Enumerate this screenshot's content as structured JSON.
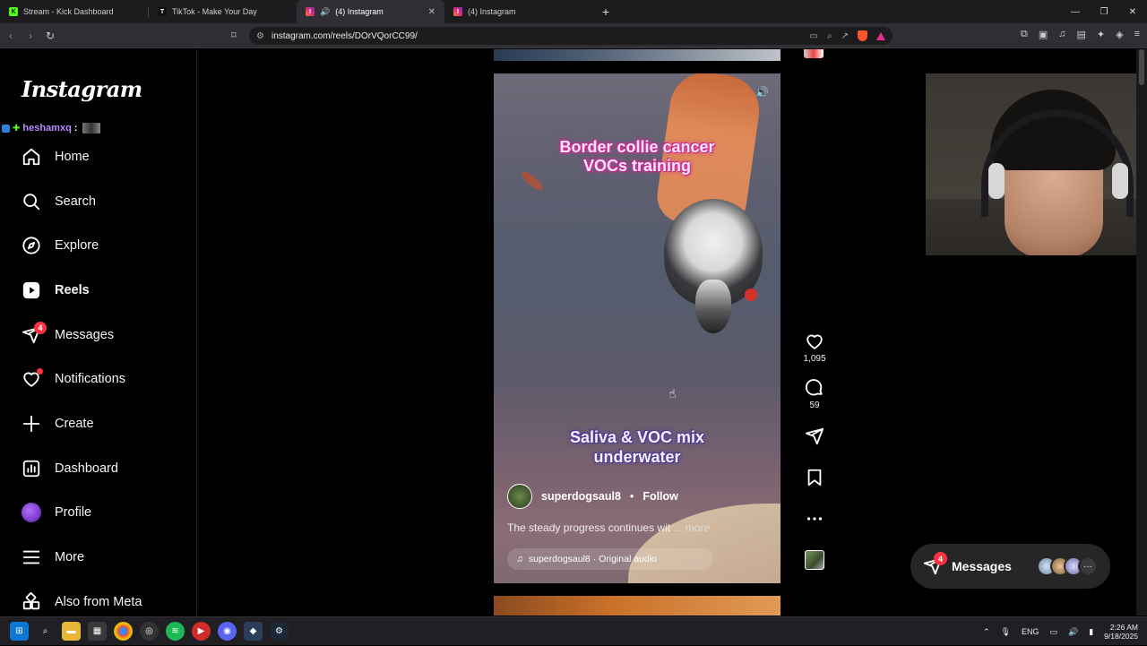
{
  "browser": {
    "tabs": [
      {
        "title": "Stream - Kick Dashboard",
        "favicon": "K",
        "favicon_color": "#53fc18"
      },
      {
        "title": "TikTok - Make Your Day",
        "favicon": "T",
        "favicon_color": "#111111"
      },
      {
        "title": "(4) Instagram",
        "favicon": "I",
        "favicon_color": "#d6249f",
        "active": true,
        "audio": true
      },
      {
        "title": "(4) Instagram",
        "favicon": "I",
        "favicon_color": "#d6249f"
      }
    ],
    "url": "instagram.com/reels/DOrVQorCC99/"
  },
  "instagram": {
    "logo": "Instagram",
    "chat_overlay": {
      "user": "heshamxq",
      "colon": ":"
    },
    "nav": [
      {
        "label": "Home",
        "icon": "home-icon"
      },
      {
        "label": "Search",
        "icon": "search-icon"
      },
      {
        "label": "Explore",
        "icon": "compass-icon"
      },
      {
        "label": "Reels",
        "icon": "reels-icon",
        "active": true
      },
      {
        "label": "Messages",
        "icon": "messenger-icon",
        "badge": "4"
      },
      {
        "label": "Notifications",
        "icon": "heart-icon",
        "dot": true
      },
      {
        "label": "Create",
        "icon": "plus-icon"
      },
      {
        "label": "Dashboard",
        "icon": "dashboard-icon"
      },
      {
        "label": "Profile",
        "icon": "avatar-icon"
      },
      {
        "label": "More",
        "icon": "menu-icon"
      },
      {
        "label": "Also from Meta",
        "icon": "meta-grid-icon"
      }
    ],
    "reel": {
      "caption_top": "Border collie cancer VOCs training",
      "caption_top_line1": "Border collie cancer",
      "caption_top_line2": "VOCs training",
      "caption_bottom_line1": "Saliva & VOC  mix",
      "caption_bottom_line2": "underwater",
      "username": "superdogsaul8",
      "dot": "•",
      "follow": "Follow",
      "description": "The steady progress continues wit",
      "more": "... more",
      "audio": "superdogsaul8 · Original audio",
      "likes": "1,095",
      "comments": "59"
    },
    "messages_pill": {
      "label": "Messages",
      "badge": "4",
      "more": "···"
    }
  },
  "taskbar": {
    "lang": "ENG",
    "time": "2:26 AM",
    "date": "9/18/2025"
  },
  "colors": {
    "accent_red": "#ff3040",
    "brave_orange": "#fb542b"
  }
}
